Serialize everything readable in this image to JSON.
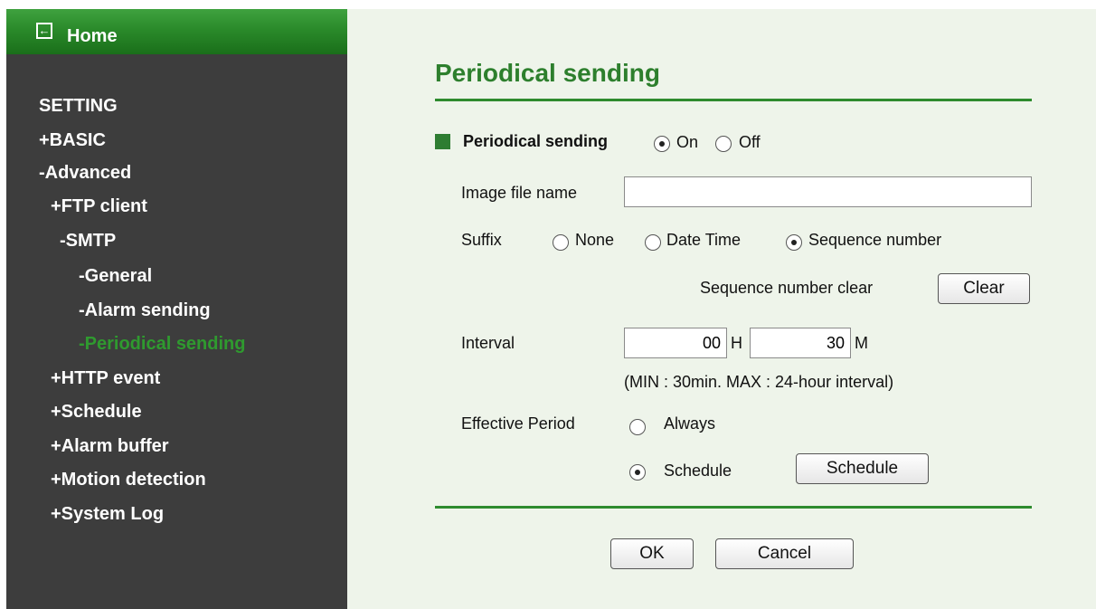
{
  "sidebar": {
    "home_label": "Home",
    "items": [
      {
        "label": "SETTING"
      },
      {
        "label": "+BASIC"
      },
      {
        "label": "-Advanced"
      },
      {
        "label": "+FTP client"
      },
      {
        "label": "-SMTP"
      },
      {
        "label": "-General"
      },
      {
        "label": "-Alarm sending"
      },
      {
        "label": "-Periodical sending"
      },
      {
        "label": "+HTTP event"
      },
      {
        "label": "+Schedule"
      },
      {
        "label": "+Alarm buffer"
      },
      {
        "label": "+Motion detection"
      },
      {
        "label": "+System Log"
      }
    ]
  },
  "main": {
    "title": "Periodical sending",
    "periodical": {
      "label": "Periodical sending",
      "on": "On",
      "off": "Off",
      "selected": "On"
    },
    "image_file_name": {
      "label": "Image file name",
      "value": ""
    },
    "suffix": {
      "label": "Suffix",
      "none": "None",
      "date_time": "Date Time",
      "sequence": "Sequence number",
      "selected": "Sequence number"
    },
    "seq_clear": {
      "label": "Sequence number clear",
      "button": "Clear"
    },
    "interval": {
      "label": "Interval",
      "hours": "00",
      "h_unit": "H",
      "minutes": "30",
      "m_unit": "M",
      "note": "(MIN : 30min. MAX : 24-hour interval)"
    },
    "effective": {
      "label": "Effective Period",
      "always": "Always",
      "schedule": "Schedule",
      "schedule_button": "Schedule",
      "selected": "Schedule"
    },
    "ok_button": "OK",
    "cancel_button": "Cancel"
  },
  "colors": {
    "sidebar_bg": "#3d3d3d",
    "accent_green": "#2d7f2d",
    "main_bg": "#eef4ea",
    "active_nav": "#2f9a2f"
  }
}
